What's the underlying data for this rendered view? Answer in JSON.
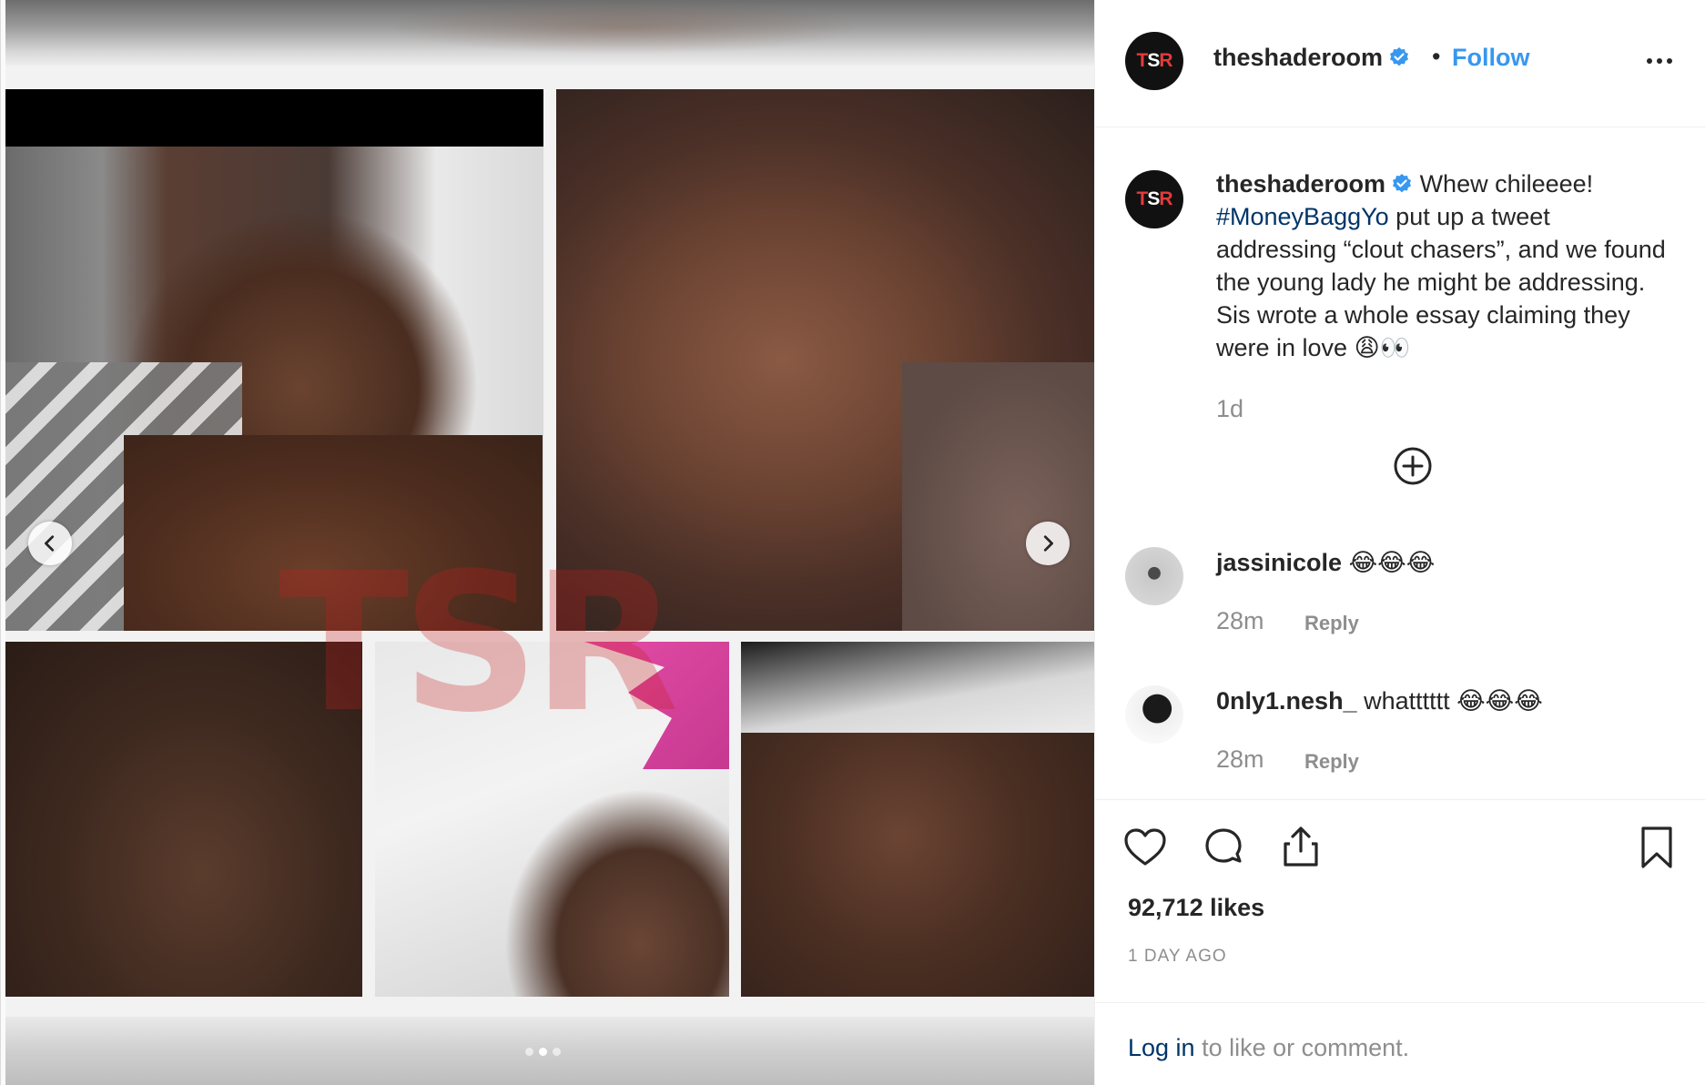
{
  "post": {
    "username": "theshaderoom",
    "avatar_initials_left": "T",
    "avatar_initials_mid": "S",
    "avatar_initials_right": "R",
    "follow_label": "Follow",
    "separator": "•",
    "caption_lead": "Whew chileeee!",
    "caption_hashtag": "#MoneyBaggYo",
    "caption_body": " put up a tweet addressing “clout chasers”, and we found the young lady he might be addressing. Sis wrote a whole essay claiming they were in love 😩👀",
    "caption_time": "1d",
    "watermark": "TSR"
  },
  "carousel": {
    "total_slides": 3,
    "active_slide": 2
  },
  "comments": [
    {
      "username": "jassinicole",
      "text": "😂😂😂",
      "time": "28m",
      "reply_label": "Reply"
    },
    {
      "username": "0nly1.nesh_",
      "text": "whatttttt 😂😂😂",
      "time": "28m",
      "reply_label": "Reply"
    }
  ],
  "footer": {
    "likes": "92,712 likes",
    "date": "1 DAY AGO",
    "login_link": "Log in",
    "login_suffix": " to like or comment."
  },
  "icons": [
    "chevron-left-icon",
    "chevron-right-icon",
    "verified-icon",
    "more-icon",
    "plus-circle-icon",
    "heart-icon",
    "comment-icon",
    "share-icon",
    "bookmark-icon"
  ],
  "colors": {
    "link_blue": "#3897f0",
    "hashtag_blue": "#003569",
    "muted": "#8e8e8e",
    "text": "#262626",
    "verified": "#3897f0"
  }
}
